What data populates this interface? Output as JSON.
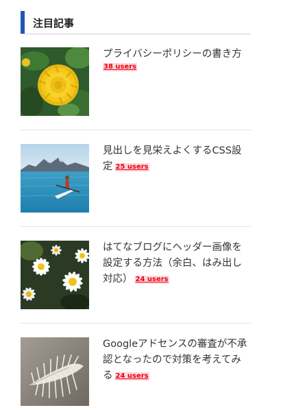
{
  "widget": {
    "title": "注目記事"
  },
  "entries": [
    {
      "title": "プライバシーポリシーの書き方",
      "users": "38 users",
      "image": "yellow-flower-photo"
    },
    {
      "title": "見出しを見栄えよくするCSS設定",
      "users": "25 users",
      "image": "kayak-lake-photo"
    },
    {
      "title": "はてなブログにヘッダー画像を設定する方法（余白、はみ出し対応）",
      "users": "24 users",
      "image": "daisies-photo"
    },
    {
      "title": "Googleアドセンスの審査が不承認となったので対策を考えてみる",
      "users": "24 users",
      "image": "seashell-photo"
    }
  ],
  "colors": {
    "accent": "#1f57b5",
    "users_text": "#e60012",
    "users_bg": "#ffd8dc"
  }
}
